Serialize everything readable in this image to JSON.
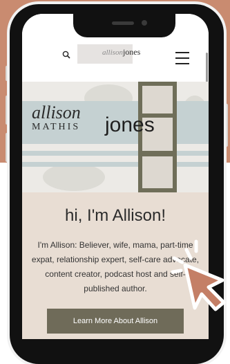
{
  "header": {
    "logo_first": "allison",
    "logo_last": "jones"
  },
  "hero": {
    "brand_first": "allison",
    "brand_middle": "MATHIS",
    "brand_last": "jones"
  },
  "intro": {
    "title": "hi, I'm Allison!",
    "body": "I'm Allison: Believer, wife, mama, part-time expat, relationship expert, self-care advocate, content creator, podcast host and self-published author.",
    "cta_label": "Learn More About Allison"
  },
  "colors": {
    "page_background": "#c98b70",
    "accent": "#6f6b59",
    "intro_background": "#e8ddd3",
    "band": "#c5d1d2"
  },
  "icons": [
    "search-icon",
    "menu-icon",
    "pointer-cursor-icon"
  ]
}
